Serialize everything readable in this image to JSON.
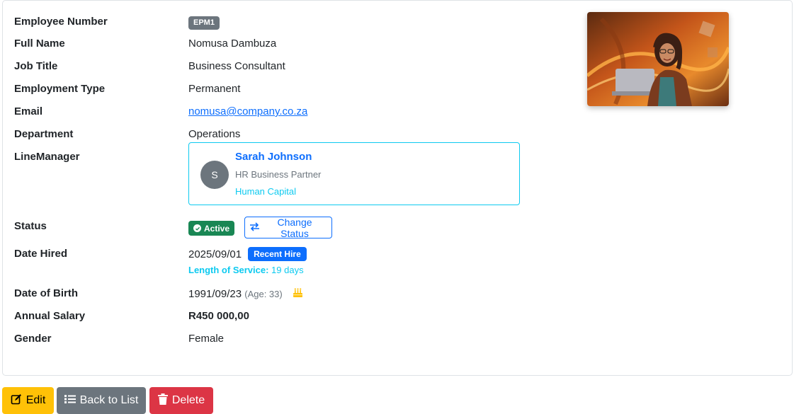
{
  "employee": {
    "fields": {
      "employee_number": {
        "label": "Employee Number",
        "value": "EPM1"
      },
      "full_name": {
        "label": "Full Name",
        "value": "Nomusa Dambuza"
      },
      "job_title": {
        "label": "Job Title",
        "value": "Business Consultant"
      },
      "employment_type": {
        "label": "Employment Type",
        "value": "Permanent"
      },
      "email": {
        "label": "Email",
        "value": "nomusa@company.co.za"
      },
      "department": {
        "label": "Department",
        "value": "Operations"
      },
      "line_manager": {
        "label": "LineManager",
        "initial": "S",
        "name": "Sarah Johnson",
        "title": "HR Business Partner",
        "department": "Human Capital"
      },
      "status": {
        "label": "Status",
        "value": "Active",
        "change_label": "Change Status"
      },
      "date_hired": {
        "label": "Date Hired",
        "value": "2025/09/01",
        "badge": "Recent Hire",
        "service_label": "Length of Service:",
        "service_value": "19 days"
      },
      "date_of_birth": {
        "label": "Date of Birth",
        "value": "1991/09/23",
        "age": "(Age: 33)",
        "icon": "birthday-cake-icon"
      },
      "annual_salary": {
        "label": "Annual Salary",
        "value": "R450 000,00"
      },
      "gender": {
        "label": "Gender",
        "value": "Female"
      }
    }
  },
  "actions": {
    "edit_label": "Edit",
    "back_label": "Back to List",
    "delete_label": "Delete"
  },
  "colors": {
    "primary": "#0d6efd",
    "info": "#0dcaf0",
    "success": "#198754",
    "secondary": "#6c757d",
    "warning": "#ffc107",
    "danger": "#dc3545"
  }
}
